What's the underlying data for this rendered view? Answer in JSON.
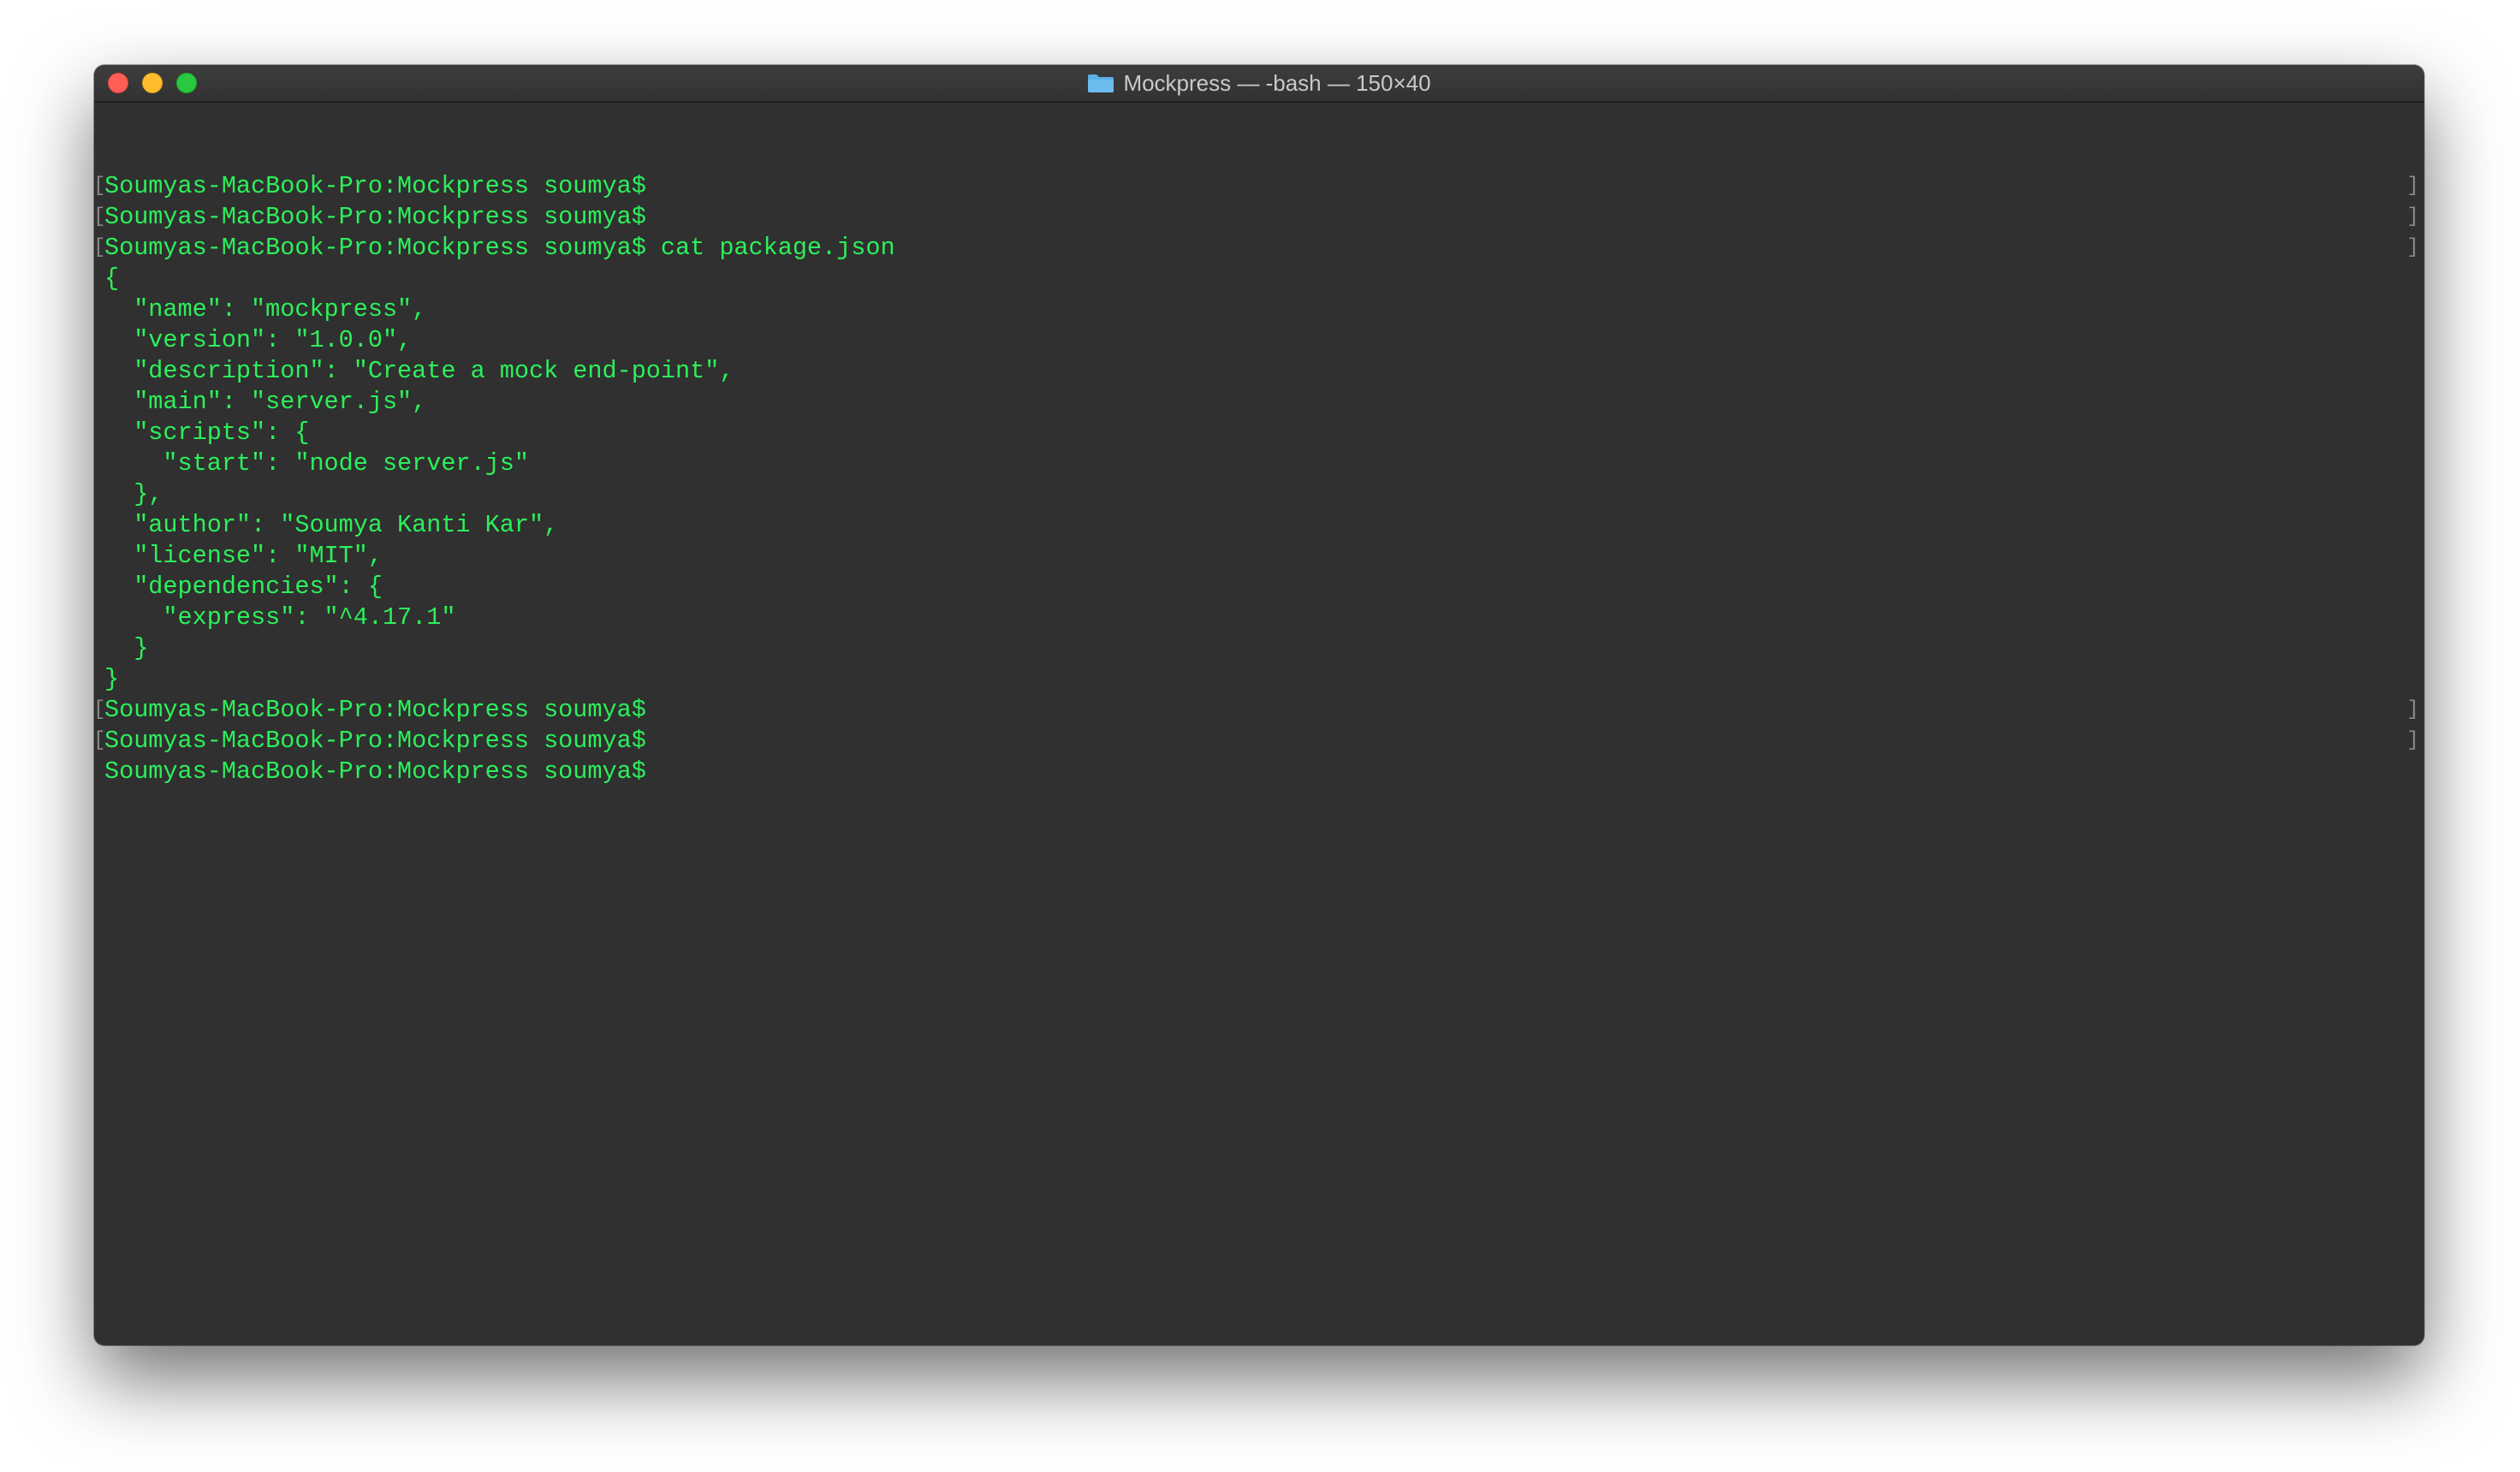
{
  "window": {
    "title": "Mockpress — -bash — 150×40",
    "title_icon": "folder-icon"
  },
  "colors": {
    "terminal_bg": "#303030",
    "terminal_text": "#2cf05a",
    "titlebar_text": "#c9c9c9"
  },
  "terminal": {
    "lines": [
      {
        "text": "Soumyas-MacBook-Pro:Mockpress soumya$",
        "marked": true
      },
      {
        "text": "Soumyas-MacBook-Pro:Mockpress soumya$",
        "marked": true
      },
      {
        "text": "Soumyas-MacBook-Pro:Mockpress soumya$ cat package.json",
        "marked": true
      },
      {
        "text": "{",
        "marked": false
      },
      {
        "text": "  \"name\": \"mockpress\",",
        "marked": false
      },
      {
        "text": "  \"version\": \"1.0.0\",",
        "marked": false
      },
      {
        "text": "  \"description\": \"Create a mock end-point\",",
        "marked": false
      },
      {
        "text": "  \"main\": \"server.js\",",
        "marked": false
      },
      {
        "text": "  \"scripts\": {",
        "marked": false
      },
      {
        "text": "    \"start\": \"node server.js\"",
        "marked": false
      },
      {
        "text": "  },",
        "marked": false
      },
      {
        "text": "  \"author\": \"Soumya Kanti Kar\",",
        "marked": false
      },
      {
        "text": "  \"license\": \"MIT\",",
        "marked": false
      },
      {
        "text": "  \"dependencies\": {",
        "marked": false
      },
      {
        "text": "    \"express\": \"^4.17.1\"",
        "marked": false
      },
      {
        "text": "  }",
        "marked": false
      },
      {
        "text": "}",
        "marked": false
      },
      {
        "text": "Soumyas-MacBook-Pro:Mockpress soumya$",
        "marked": true
      },
      {
        "text": "Soumyas-MacBook-Pro:Mockpress soumya$",
        "marked": true
      },
      {
        "text": "Soumyas-MacBook-Pro:Mockpress soumya$",
        "marked": false
      }
    ]
  }
}
